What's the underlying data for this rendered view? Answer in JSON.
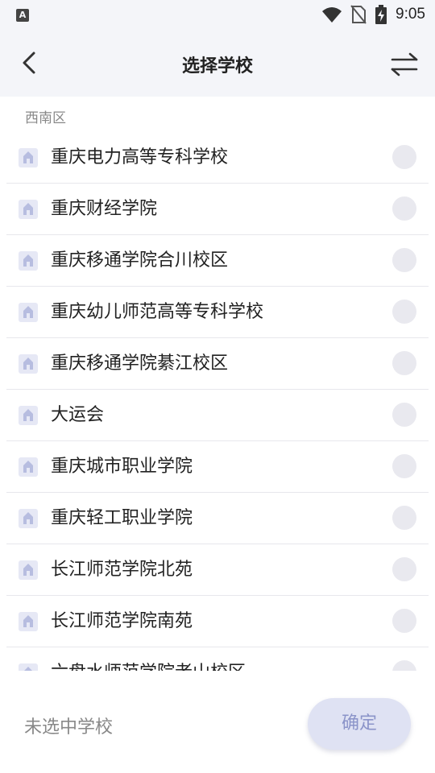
{
  "status_bar": {
    "left_icon": "A",
    "time": "9:05",
    "icons": [
      "wifi-icon",
      "no-sim-icon",
      "battery-charging-icon"
    ]
  },
  "header": {
    "title": "选择学校",
    "back_icon": "chevron-left-icon",
    "switch_icon": "swap-arrows-icon"
  },
  "section": {
    "label": "西南区"
  },
  "schools": [
    "重庆电力高等专科学校",
    "重庆财经学院",
    "重庆移通学院合川校区",
    "重庆幼儿师范高等专科学校",
    "重庆移通学院綦江校区",
    "大运会",
    "重庆城市职业学院",
    "重庆轻工职业学院",
    "长江师范学院北苑",
    "长江师范学院南苑",
    "六盘水师范学院老山校区"
  ],
  "footer": {
    "selection_status": "未选中学校",
    "confirm_label": "确定"
  },
  "colors": {
    "background": "#f4f5f9",
    "icon_tint": "#c8cde8",
    "radio": "#e9e9ef",
    "confirm_bg": "#dfe2f3",
    "confirm_text": "#8b94c9"
  }
}
